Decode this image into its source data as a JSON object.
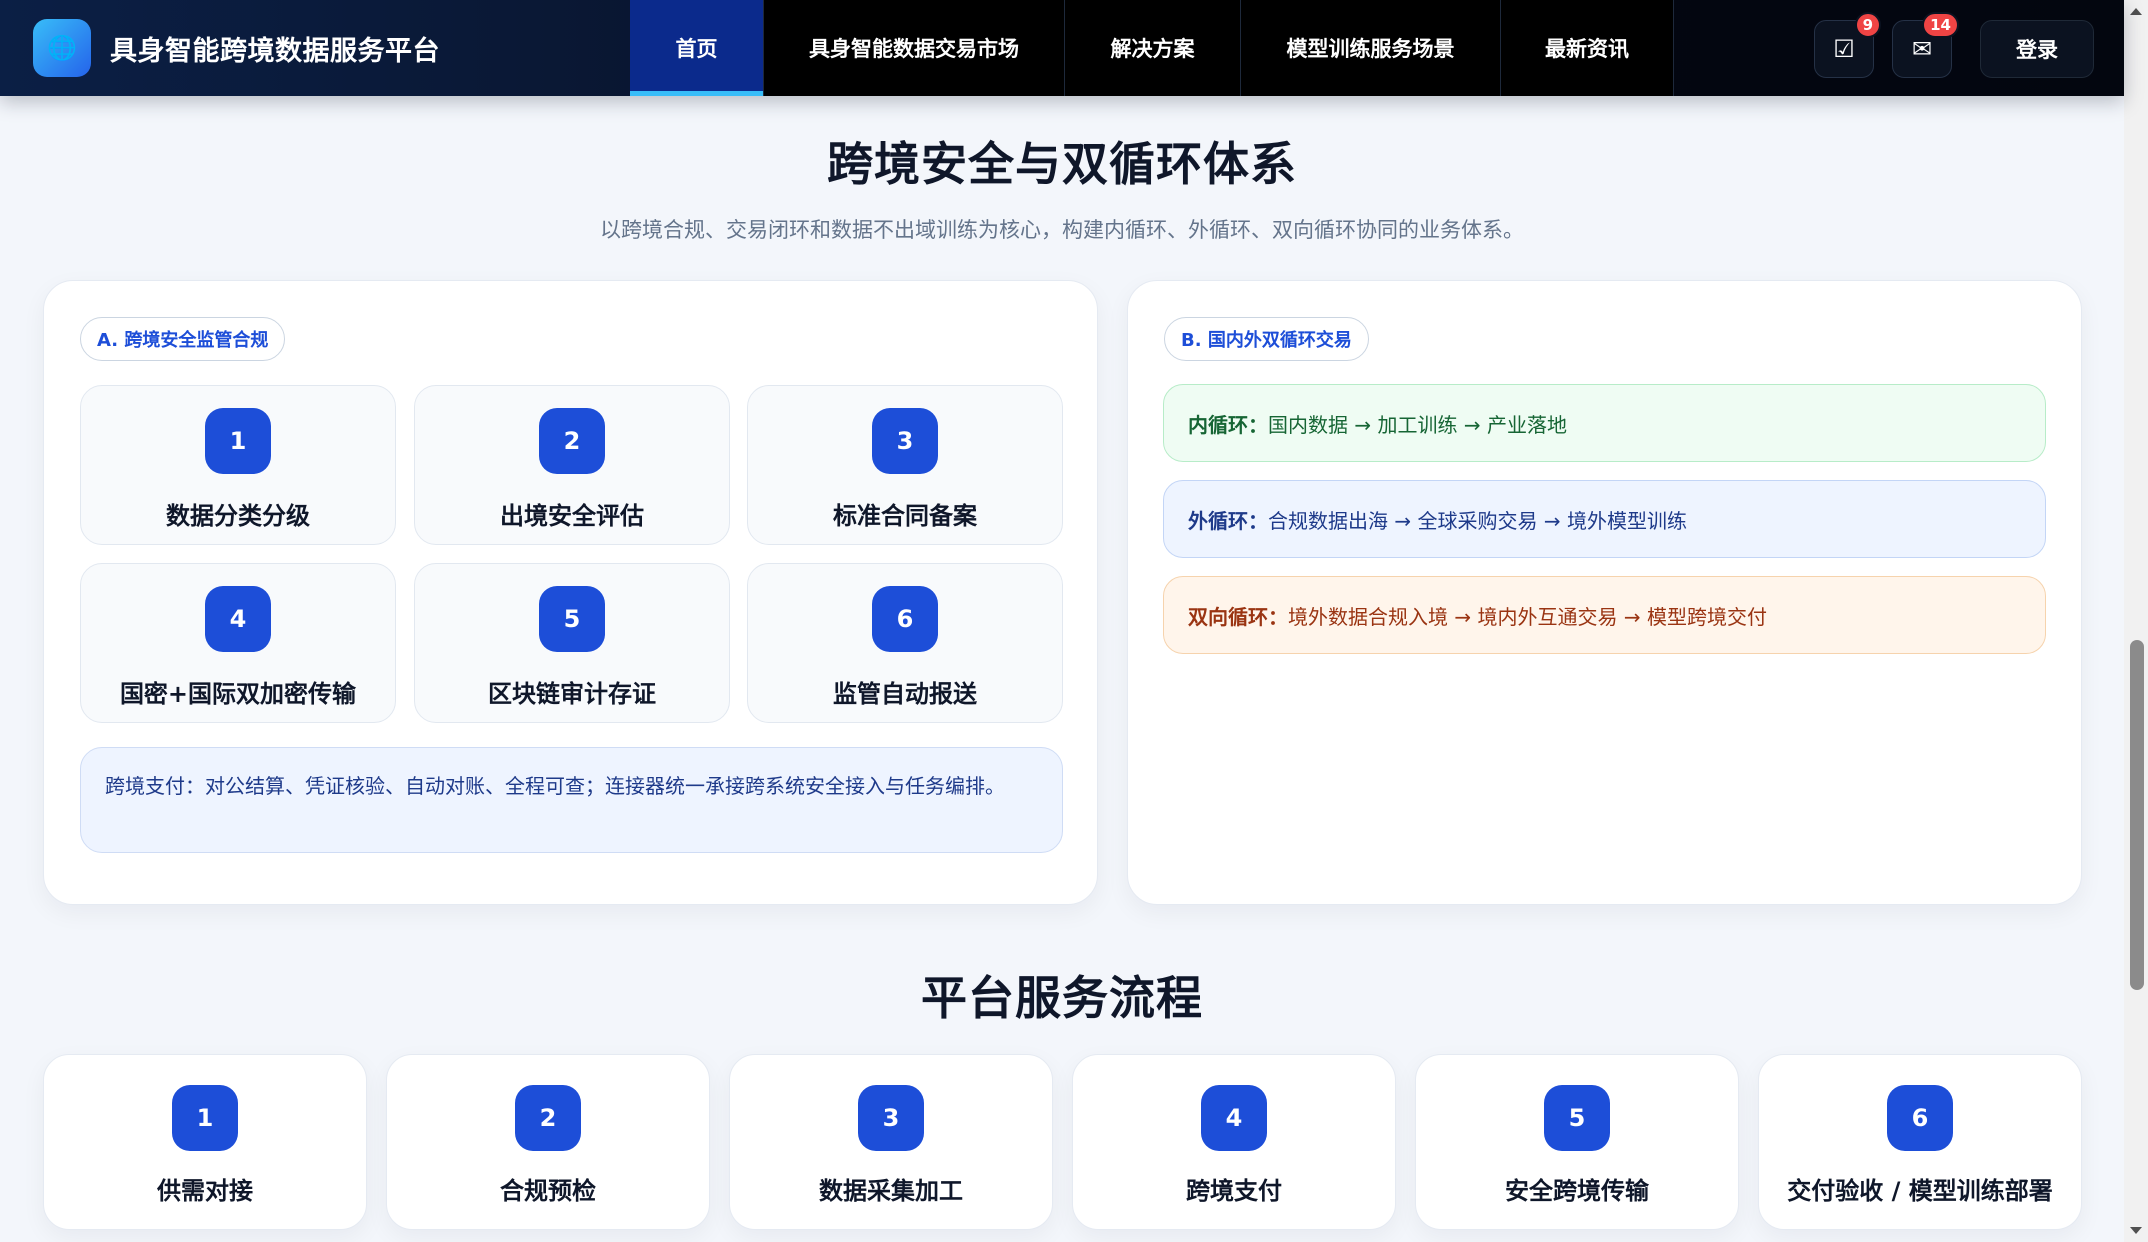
{
  "header": {
    "logo_icon": "globe-icon",
    "title": "具身智能跨境数据服务平台",
    "nav": [
      {
        "label": "首页",
        "active": true
      },
      {
        "label": "具身智能数据交易市场",
        "active": false
      },
      {
        "label": "解决方案",
        "active": false
      },
      {
        "label": "模型训练服务场景",
        "active": false
      },
      {
        "label": "最新资讯",
        "active": false
      }
    ],
    "tasks_icon": "☑",
    "tasks_badge": "9",
    "mail_icon": "✉",
    "mail_badge": "14",
    "login_label": "登录"
  },
  "security": {
    "title": "跨境安全与双循环体系",
    "subtitle": "以跨境合规、交易闭环和数据不出域训练为核心，构建内循环、外循环、双向循环协同的业务体系。",
    "left_card": {
      "pill": "A. 跨境安全监管合规",
      "items": [
        {
          "num": "1",
          "label": "数据分类分级"
        },
        {
          "num": "2",
          "label": "出境安全评估"
        },
        {
          "num": "3",
          "label": "标准合同备案"
        },
        {
          "num": "4",
          "label": "国密+国际双加密传输"
        },
        {
          "num": "5",
          "label": "区块链审计存证"
        },
        {
          "num": "6",
          "label": "监管自动报送"
        }
      ],
      "note": "跨境支付：对公结算、凭证核验、自动对账、全程可查；连接器统一承接跨系统安全接入与任务编排。"
    },
    "right_card": {
      "pill": "B. 国内外双循环交易",
      "loops": [
        {
          "name": "内循环：",
          "text": "国内数据 → 加工训练 → 产业落地",
          "color": "#166534"
        },
        {
          "name": "外循环：",
          "text": "合规数据出海 → 全球采购交易 → 境外模型训练",
          "color": "#1e3a8a"
        },
        {
          "name": "双向循环：",
          "text": "境外数据合规入境 → 境内外互通交易 → 模型跨境交付",
          "color": "#9a3412"
        }
      ]
    }
  },
  "process": {
    "title": "平台服务流程",
    "steps": [
      {
        "num": "1",
        "label": "供需对接"
      },
      {
        "num": "2",
        "label": "合规预检"
      },
      {
        "num": "3",
        "label": "数据采集加工"
      },
      {
        "num": "4",
        "label": "跨境支付"
      },
      {
        "num": "5",
        "label": "安全跨境传输"
      },
      {
        "num": "6",
        "label": "交付验收 / 模型训练部署"
      }
    ]
  }
}
